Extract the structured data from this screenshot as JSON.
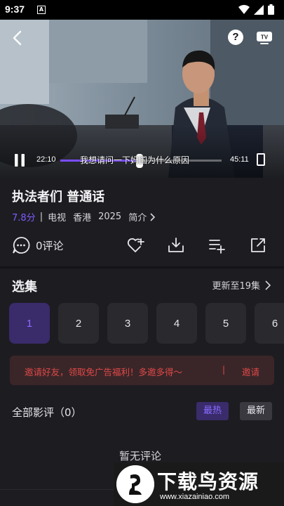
{
  "status_bar": {
    "time": "9:37",
    "badge": "A",
    "icons": [
      "wifi-icon",
      "signal-icon",
      "battery-icon"
    ]
  },
  "player": {
    "current_time": "22:10",
    "total_time": "45:11",
    "subtitle": "我想请问一下妈国为什么原因",
    "progress": 0.49,
    "icons": [
      "back-icon",
      "help-icon",
      "tv-cast-icon",
      "pause-icon",
      "fullscreen-icon"
    ]
  },
  "show": {
    "title": "执法者们 普通话",
    "rating": "7.8分",
    "separator": "|",
    "type": "电视",
    "region": "香港",
    "year": "2025",
    "intro_label": "简介"
  },
  "actions": {
    "comment_label": "0评论",
    "icons": [
      "comment-icon",
      "favorite-add-icon",
      "download-icon",
      "add-to-list-icon",
      "share-icon"
    ]
  },
  "episodes": {
    "header": "选集",
    "update_label": "更新至19集",
    "items": [
      "1",
      "2",
      "3",
      "4",
      "5",
      "6"
    ],
    "active": "1"
  },
  "invite": {
    "text": "邀请好友，领取免广告福利！多邀多得～",
    "separator": "|",
    "button": "邀请"
  },
  "reviews": {
    "title": "全部影评（0）",
    "sort_hot": "最热",
    "sort_new": "最新",
    "empty": "暂无评论"
  },
  "watermark": {
    "title": "下载鸟资源",
    "url": "www.xiazainiao.com"
  },
  "colors": {
    "accent": "#7d5cff",
    "invite_text": "#e04848",
    "background": "#1d1c21"
  }
}
